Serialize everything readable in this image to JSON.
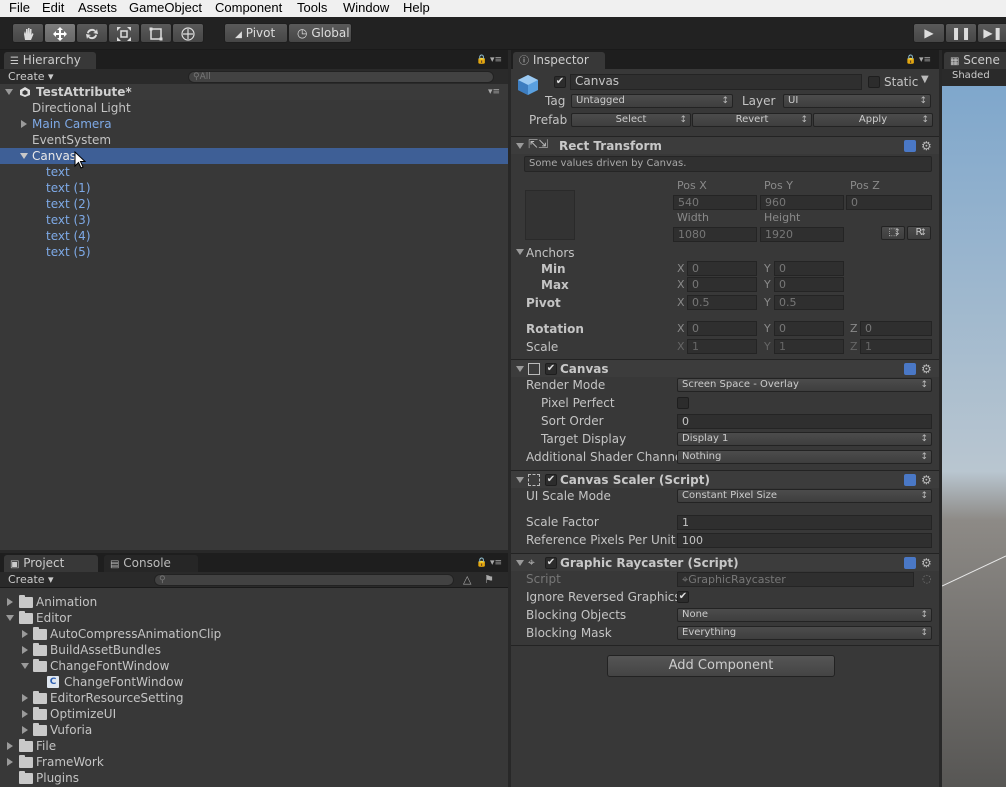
{
  "menu": [
    "File",
    "Edit",
    "Assets",
    "GameObject",
    "Component",
    "Tools",
    "Window",
    "Help"
  ],
  "toolbar": {
    "pivot": "Pivot",
    "global": "Global"
  },
  "hierarchy": {
    "tab": "Hierarchy",
    "create": "Create",
    "search_placeholder": "All",
    "scene": "TestAttribute*",
    "items": [
      "Directional Light",
      "Main Camera",
      "EventSystem",
      "Canvas",
      "text",
      "text (1)",
      "text (2)",
      "text (3)",
      "text (4)",
      "text (5)"
    ]
  },
  "project": {
    "tab": "Project",
    "console_tab": "Console",
    "create": "Create",
    "folders": [
      "Animation",
      "Editor",
      "AutoCompressAnimationClip",
      "BuildAssetBundles",
      "ChangeFontWindow",
      "ChangeFontWindow",
      "EditorResourceSetting",
      "OptimizeUI",
      "Vuforia",
      "File",
      "FrameWork",
      "Plugins"
    ]
  },
  "inspector": {
    "tab": "Inspector",
    "object_name": "Canvas",
    "static_label": "Static",
    "tag_label": "Tag",
    "tag_value": "Untagged",
    "layer_label": "Layer",
    "layer_value": "UI",
    "prefab_label": "Prefab",
    "prefab_select": "Select",
    "prefab_revert": "Revert",
    "prefab_apply": "Apply",
    "rect": {
      "title": "Rect Transform",
      "note": "Some values driven by Canvas.",
      "posx_label": "Pos X",
      "posy_label": "Pos Y",
      "posz_label": "Pos Z",
      "posx": "540",
      "posy": "960",
      "posz": "0",
      "width_label": "Width",
      "height_label": "Height",
      "width": "1080",
      "height": "1920",
      "r_button": "R",
      "anchors": "Anchors",
      "min": "Min",
      "max": "Max",
      "min_x": "0",
      "min_y": "0",
      "max_x": "0",
      "max_y": "0",
      "pivot": "Pivot",
      "pivot_x": "0.5",
      "pivot_y": "0.5",
      "rotation": "Rotation",
      "rot_x": "0",
      "rot_y": "0",
      "rot_z": "0",
      "scale": "Scale",
      "scale_x": "1",
      "scale_y": "1",
      "scale_z": "1",
      "x": "X",
      "y": "Y",
      "z": "Z"
    },
    "canvas": {
      "title": "Canvas",
      "render_mode_label": "Render Mode",
      "render_mode": "Screen Space - Overlay",
      "pixel_perfect": "Pixel Perfect",
      "sort_order_label": "Sort Order",
      "sort_order": "0",
      "target_display_label": "Target Display",
      "target_display": "Display 1",
      "shader_label": "Additional Shader Channe",
      "shader_value": "Nothing"
    },
    "scaler": {
      "title": "Canvas Scaler (Script)",
      "scale_mode_label": "UI Scale Mode",
      "scale_mode": "Constant Pixel Size",
      "scale_factor_label": "Scale Factor",
      "scale_factor": "1",
      "ref_pixels_label": "Reference Pixels Per Unit",
      "ref_pixels": "100"
    },
    "raycaster": {
      "title": "Graphic Raycaster (Script)",
      "script_label": "Script",
      "script_value": "GraphicRaycaster",
      "ignore_label": "Ignore Reversed Graphics",
      "blocking_objects_label": "Blocking Objects",
      "blocking_objects": "None",
      "blocking_mask_label": "Blocking Mask",
      "blocking_mask": "Everything"
    },
    "add_component": "Add Component"
  },
  "scene": {
    "tab": "Scene",
    "shading": "Shaded"
  },
  "colors": {
    "selection": "#3e5f96",
    "link_blue": "#7ea9e6",
    "help_blue": "#4a78c6"
  }
}
